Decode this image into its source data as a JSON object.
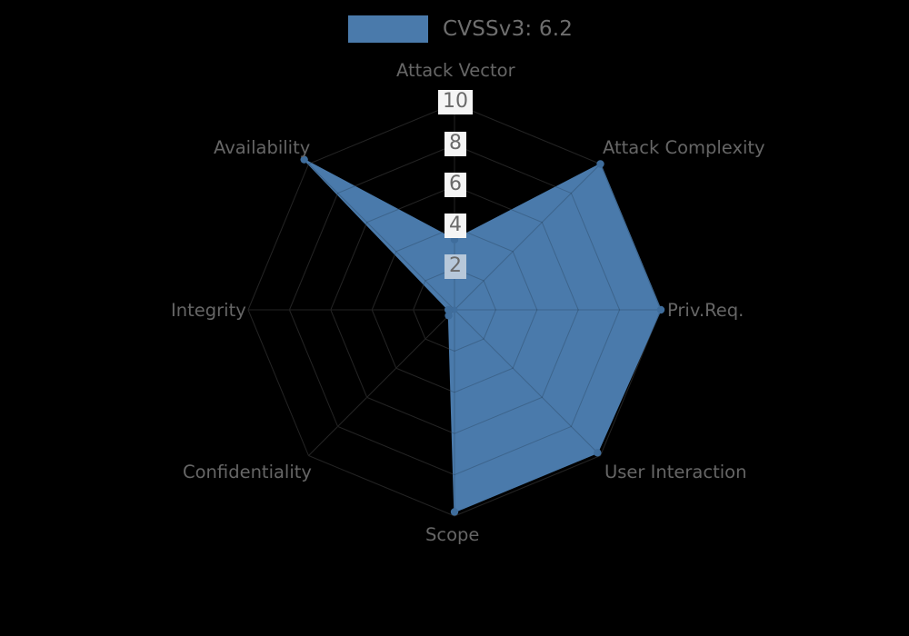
{
  "legend": {
    "label": "CVSSv3: 6.2",
    "swatch_color": "#4a7aab"
  },
  "background_color": "#000000",
  "axis_labels": {
    "attack_vector": "Attack Vector",
    "attack_complexity": "Attack Complexity",
    "priv_req": "Priv.Req.",
    "user_interaction": "User Interaction",
    "scope": "Scope",
    "confidentiality": "Confidentiality",
    "integrity": "Integrity",
    "availability": "Availability"
  },
  "ticks": {
    "t10": "10",
    "t8": "8",
    "t6": "6",
    "t4": "4",
    "t2": "2"
  },
  "chart_data": {
    "type": "radar",
    "title": "CVSSv3: 6.2",
    "series": [
      {
        "name": "CVSSv3: 6.2",
        "color": "#4a7aab",
        "values": [
          3.4,
          10.0,
          10.0,
          9.8,
          9.8,
          0.4,
          0.3,
          10.3
        ]
      }
    ],
    "categories": [
      "Attack Vector",
      "Attack Complexity",
      "Priv.Req.",
      "User Interaction",
      "Scope",
      "Confidentiality",
      "Integrity",
      "Availability"
    ],
    "tick_values": [
      2,
      4,
      6,
      8,
      10
    ],
    "rlim": [
      0,
      10
    ],
    "grid": true,
    "legend_position": "top",
    "xlabel": "",
    "ylabel": ""
  }
}
